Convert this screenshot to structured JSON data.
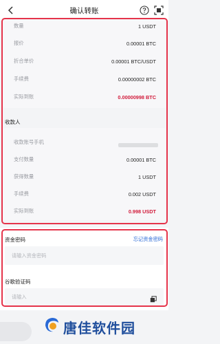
{
  "header": {
    "title": "确认转账"
  },
  "summary": {
    "rows": [
      {
        "key": "数量",
        "value": "1 USDT",
        "red": false
      },
      {
        "key": "报价",
        "value": "0.00001 BTC",
        "red": false
      },
      {
        "key": "折合单价",
        "value": "0.00001 BTC/USDT",
        "red": false
      },
      {
        "key": "手续费",
        "value": "0.00000002 BTC",
        "red": false
      },
      {
        "key": "实际到账",
        "value": "0.00000998 BTC",
        "red": true
      }
    ]
  },
  "payee": {
    "title": "收款人",
    "rows": [
      {
        "key": "收款账号手机",
        "value": "",
        "red": false
      },
      {
        "key": "支付数量",
        "value": "0.00001 BTC",
        "red": false
      },
      {
        "key": "获得数量",
        "value": "1 USDT",
        "red": false
      },
      {
        "key": "手续费",
        "value": "0.002 USDT",
        "red": false
      },
      {
        "key": "实际到账",
        "value": "0.998 USDT",
        "red": true
      }
    ]
  },
  "fund_password": {
    "label": "资金密码",
    "forgot": "忘记资金密码",
    "placeholder": "请输入资金密码"
  },
  "google_code": {
    "label": "谷歌验证码",
    "placeholder": "请输入"
  },
  "watermark": {
    "text": "唐佳软件园"
  },
  "colors": {
    "accent_red": "#e5334a",
    "value_red": "#d11a3a",
    "link_blue": "#2a6ad6"
  }
}
